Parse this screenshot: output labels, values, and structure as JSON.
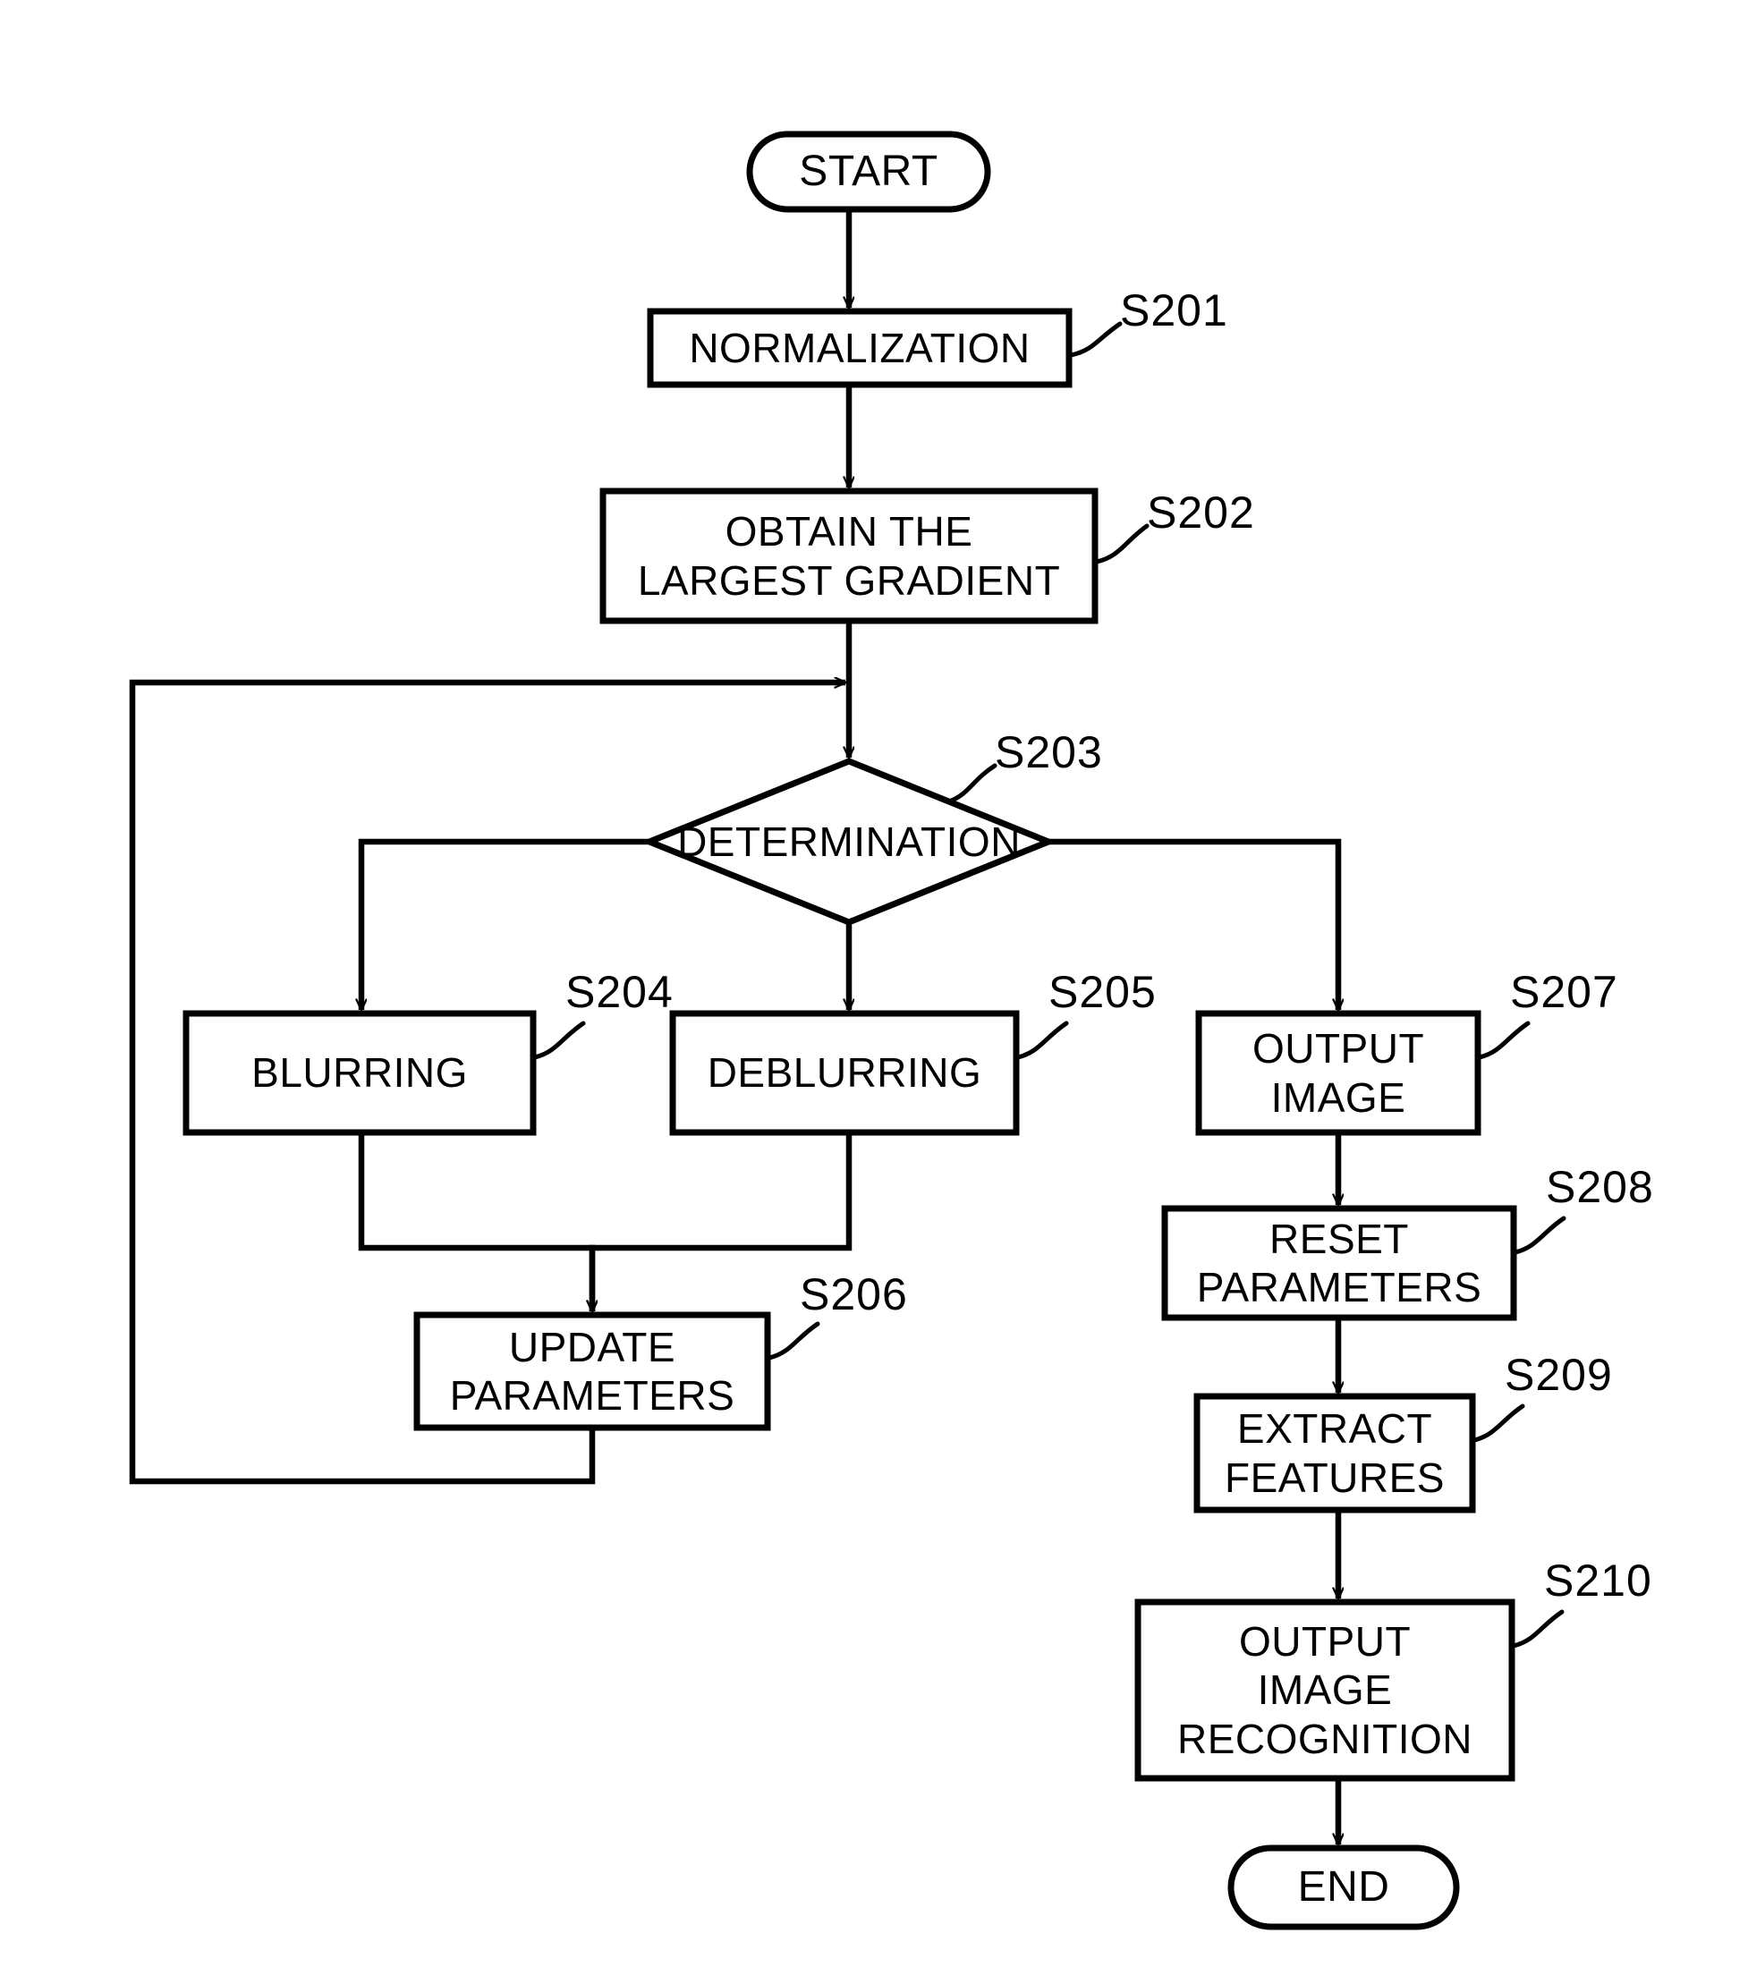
{
  "diagram": {
    "type": "flowchart",
    "title": "",
    "stroke_color": "#000000",
    "fill_color": "#ffffff",
    "background_color": "#ffffff"
  },
  "nodes": {
    "start": {
      "label": "START",
      "shape": "terminator"
    },
    "normalization": {
      "label": "NORMALIZATION",
      "shape": "process",
      "step": "S201"
    },
    "obtain_gradient": {
      "label": "OBTAIN THE\nLARGEST GRADIENT",
      "shape": "process",
      "step": "S202"
    },
    "determination": {
      "label": "DETERMINATION",
      "shape": "decision",
      "step": "S203"
    },
    "blurring": {
      "label": "BLURRING",
      "shape": "process",
      "step": "S204"
    },
    "deblurring": {
      "label": "DEBLURRING",
      "shape": "process",
      "step": "S205"
    },
    "update_parameters": {
      "label": "UPDATE\nPARAMETERS",
      "shape": "process",
      "step": "S206"
    },
    "output_image": {
      "label": "OUTPUT\nIMAGE",
      "shape": "process",
      "step": "S207"
    },
    "reset_parameters": {
      "label": "RESET\nPARAMETERS",
      "shape": "process",
      "step": "S208"
    },
    "extract_features": {
      "label": "EXTRACT\nFEATURES",
      "shape": "process",
      "step": "S209"
    },
    "output_image_recognition": {
      "label": "OUTPUT\nIMAGE\nRECOGNITION",
      "shape": "process",
      "step": "S210"
    },
    "end": {
      "label": "END",
      "shape": "terminator"
    }
  },
  "step_labels": {
    "s201": "S201",
    "s202": "S202",
    "s203": "S203",
    "s204": "S204",
    "s205": "S205",
    "s206": "S206",
    "s207": "S207",
    "s208": "S208",
    "s209": "S209",
    "s210": "S210"
  },
  "edges": [
    {
      "from": "start",
      "to": "normalization",
      "label": ""
    },
    {
      "from": "normalization",
      "to": "obtain_gradient",
      "label": ""
    },
    {
      "from": "obtain_gradient",
      "to": "determination",
      "label": ""
    },
    {
      "from": "determination",
      "to": "blurring",
      "label": ""
    },
    {
      "from": "determination",
      "to": "deblurring",
      "label": ""
    },
    {
      "from": "determination",
      "to": "output_image",
      "label": ""
    },
    {
      "from": "blurring",
      "to": "update_parameters",
      "label": ""
    },
    {
      "from": "deblurring",
      "to": "update_parameters",
      "label": ""
    },
    {
      "from": "update_parameters",
      "to": "determination",
      "label": ""
    },
    {
      "from": "output_image",
      "to": "reset_parameters",
      "label": ""
    },
    {
      "from": "reset_parameters",
      "to": "extract_features",
      "label": ""
    },
    {
      "from": "extract_features",
      "to": "output_image_recognition",
      "label": ""
    },
    {
      "from": "output_image_recognition",
      "to": "end",
      "label": ""
    }
  ]
}
